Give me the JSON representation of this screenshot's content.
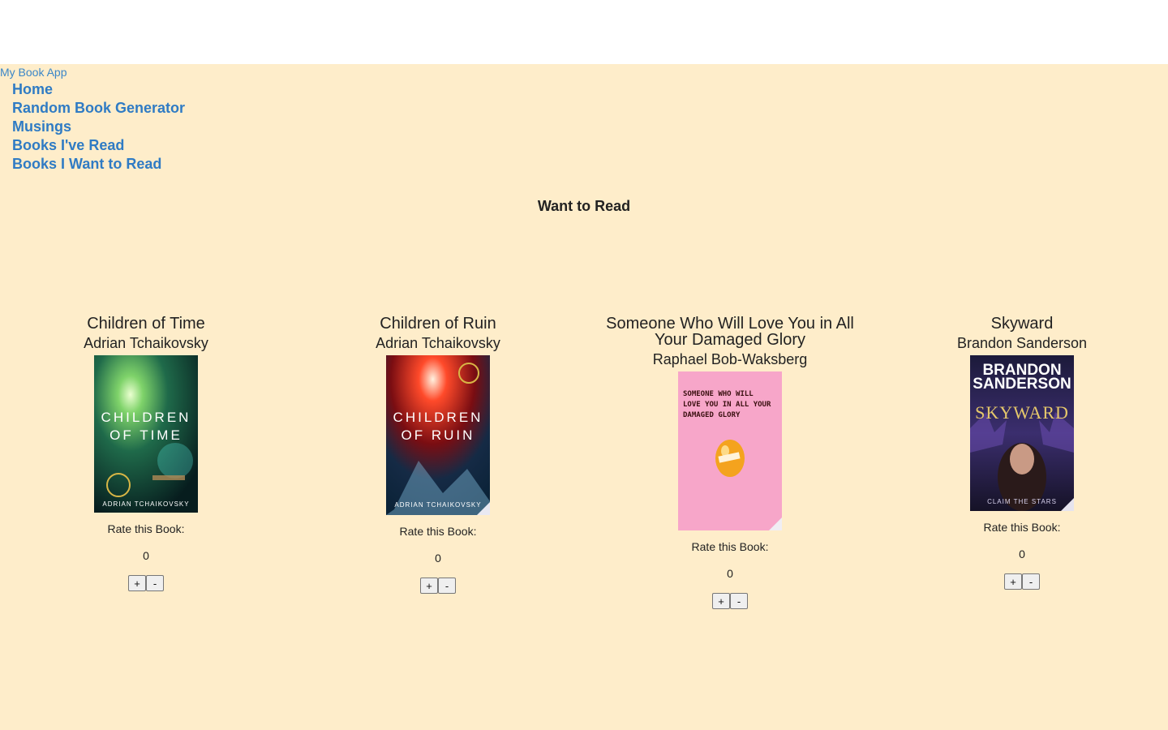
{
  "header": {
    "brand": "My Book App"
  },
  "nav": {
    "items": [
      {
        "label": "Home"
      },
      {
        "label": "Random Book Generator"
      },
      {
        "label": "Musings"
      },
      {
        "label": "Books I've Read"
      },
      {
        "label": "Books I Want to Read"
      }
    ]
  },
  "section_title": "Want to Read",
  "rate_label": "Rate this Book:",
  "plus_label": "+",
  "minus_label": "-",
  "books": [
    {
      "title": "Children of Time",
      "author": "Adrian Tchaikovsky",
      "rating": "0"
    },
    {
      "title": "Children of Ruin",
      "author": "Adrian Tchaikovsky",
      "rating": "0"
    },
    {
      "title": "Someone Who Will Love You in All Your Damaged Glory",
      "author": "Raphael Bob-Waksberg",
      "rating": "0"
    },
    {
      "title": "Skyward",
      "author": "Brandon Sanderson",
      "rating": "0"
    }
  ],
  "colors": {
    "page_background": "#feedca",
    "link": "#2f7bc4"
  }
}
